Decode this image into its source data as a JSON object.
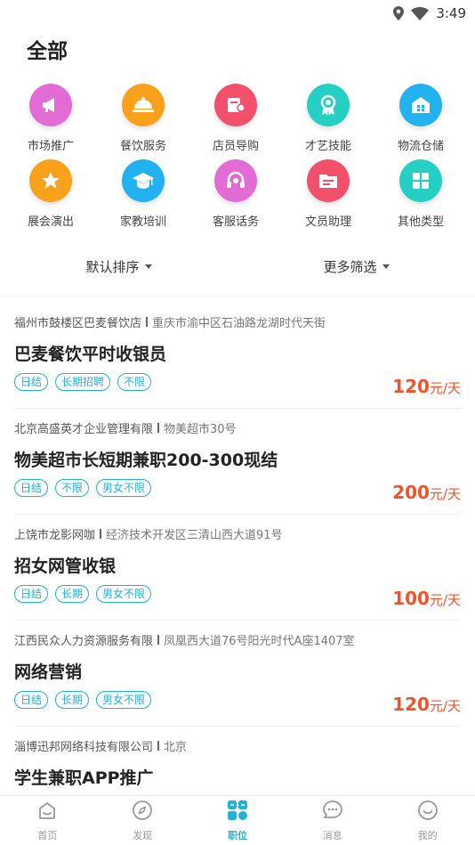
{
  "status": {
    "time": "3:49"
  },
  "page": {
    "title": "全部"
  },
  "categories": [
    {
      "label": "市场推广",
      "icon": "megaphone-icon",
      "color": "#e36bd6"
    },
    {
      "label": "餐饮服务",
      "icon": "food-tray-icon",
      "color": "#f9a11b"
    },
    {
      "label": "店员导购",
      "icon": "shop-assistant-icon",
      "color": "#f2506b"
    },
    {
      "label": "才艺技能",
      "icon": "award-ribbon-icon",
      "color": "#25cfc4"
    },
    {
      "label": "物流仓储",
      "icon": "warehouse-icon",
      "color": "#23b2f0"
    },
    {
      "label": "展会演出",
      "icon": "star-icon",
      "color": "#f9a11b"
    },
    {
      "label": "家教培训",
      "icon": "graduation-cap-icon",
      "color": "#23b2f0"
    },
    {
      "label": "客服话务",
      "icon": "headset-icon",
      "color": "#e36bd6"
    },
    {
      "label": "文员助理",
      "icon": "folder-icon",
      "color": "#f2506b"
    },
    {
      "label": "其他类型",
      "icon": "grid-icon",
      "color": "#25cfc4"
    }
  ],
  "sort": {
    "default_label": "默认排序",
    "filter_label": "更多筛选"
  },
  "jobs": [
    {
      "company": "福州市鼓楼区巴麦餐饮店",
      "address": "重庆市渝中区石油路龙湖时代天街",
      "title": "巴麦餐饮平时收银员",
      "tags": [
        "日结",
        "长期招聘",
        "不限"
      ],
      "salary": "120",
      "unit": "元/天"
    },
    {
      "company": "北京高盛英才企业管理有限",
      "address": "物美超市30号",
      "title": "物美超市长短期兼职200-300现结",
      "tags": [
        "日结",
        "不限",
        "男女不限"
      ],
      "salary": "200",
      "unit": "元/天"
    },
    {
      "company": "上饶市龙影网咖",
      "address": "经济技术开发区三清山西大道91号",
      "title": "招女网管收银",
      "tags": [
        "日结",
        "长期",
        "男女不限"
      ],
      "salary": "100",
      "unit": "元/天"
    },
    {
      "company": "江西民众人力资源服务有限",
      "address": "凤凰西大道76号阳光时代A座1407室",
      "title": "网络营销",
      "tags": [
        "日结",
        "长期",
        "男女不限"
      ],
      "salary": "120",
      "unit": "元/天"
    },
    {
      "company": "淄博迅邦网络科技有限公司",
      "address": "北京",
      "title": "学生兼职APP推广",
      "tags": [],
      "salary": "",
      "unit": ""
    }
  ],
  "tabs": [
    {
      "label": "首页",
      "icon": "home-icon",
      "active": false
    },
    {
      "label": "发现",
      "icon": "compass-icon",
      "active": false
    },
    {
      "label": "职位",
      "icon": "jobs-grid-icon",
      "active": true
    },
    {
      "label": "消息",
      "icon": "message-icon",
      "active": false
    },
    {
      "label": "我的",
      "icon": "profile-icon",
      "active": false
    }
  ],
  "colors": {
    "accent": "#21b2d6",
    "salary": "#f1532b"
  }
}
